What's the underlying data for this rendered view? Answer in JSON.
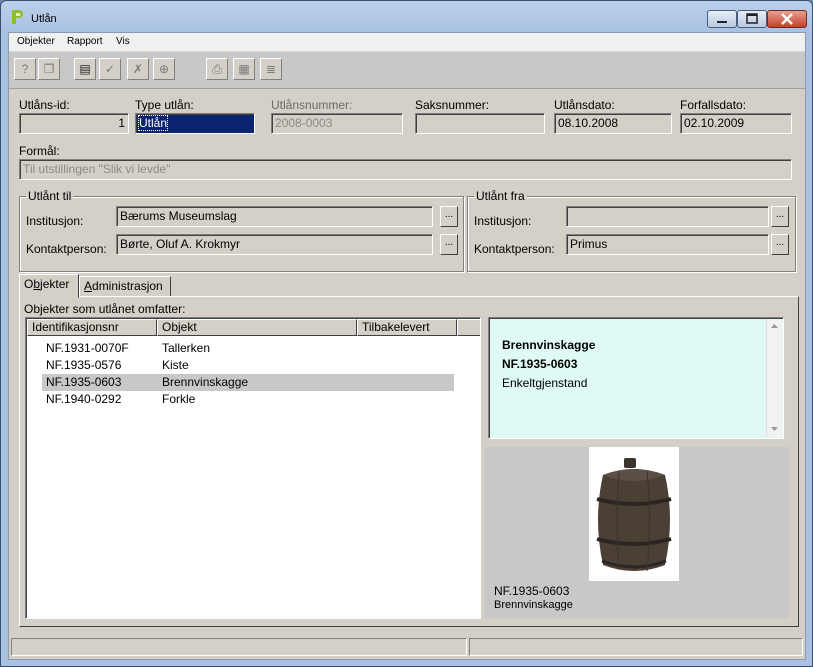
{
  "window": {
    "title": "Utlån"
  },
  "menu": [
    "Objekter",
    "Rapport",
    "Vis"
  ],
  "toolbar": {
    "icons": [
      "help-search-icon",
      "copy-icon",
      "new-record-icon",
      "confirm-icon",
      "delete-icon",
      "lock-icon",
      "print-icon",
      "print-preview-icon",
      "export-icon"
    ]
  },
  "fields": {
    "utlans_id": {
      "label": "Utlåns-id:",
      "value": "1"
    },
    "type_utlan": {
      "label": "Type utlån:",
      "value": "Utlån"
    },
    "utlansnummer": {
      "label": "Utlånsnummer:",
      "value": "2008-0003"
    },
    "saksnummer": {
      "label": "Saksnummer:",
      "value": ""
    },
    "utlansdato": {
      "label": "Utlånsdato:",
      "value": "08.10.2008"
    },
    "forfallsdato": {
      "label": "Forfallsdato:",
      "value": "02.10.2009"
    },
    "formal": {
      "label": "Formål:",
      "value": "Til utstillingen \"Slik vi levde\""
    }
  },
  "utlant_til": {
    "title": "Utlånt til",
    "institusjon_label": "Institusjon:",
    "institusjon": "Bærums Museumslag",
    "kontaktperson_label": "Kontaktperson:",
    "kontaktperson": "Børte, Oluf A. Krokmyr",
    "browse": "..."
  },
  "utlant_fra": {
    "title": "Utlånt fra",
    "institusjon_label": "Institusjon:",
    "institusjon": "",
    "kontaktperson_label": "Kontaktperson:",
    "kontaktperson": "Primus",
    "browse": "..."
  },
  "tabs": [
    "Objekter",
    "Administrasjon"
  ],
  "objects_panel": {
    "caption": "Objekter som utlånet omfatter:",
    "columns": [
      "Identifikasjonsnr",
      "Objekt",
      "Tilbakelevert"
    ],
    "rows": [
      {
        "id": "NF.1931-0070F",
        "objekt": "Tallerken",
        "tilbakelevert": ""
      },
      {
        "id": "NF.1935-0576",
        "objekt": "Kiste",
        "tilbakelevert": ""
      },
      {
        "id": "NF.1935-0603",
        "objekt": "Brennvinskagge",
        "tilbakelevert": ""
      },
      {
        "id": "NF.1940-0292",
        "objekt": "Forkle",
        "tilbakelevert": ""
      }
    ],
    "selected_index": 2
  },
  "detail": {
    "name": "Brennvinskagge",
    "id": "NF.1935-0603",
    "category": "Enkeltgjenstand",
    "image_caption_id": "NF.1935-0603",
    "image_caption_name": "Brennvinskagge"
  }
}
